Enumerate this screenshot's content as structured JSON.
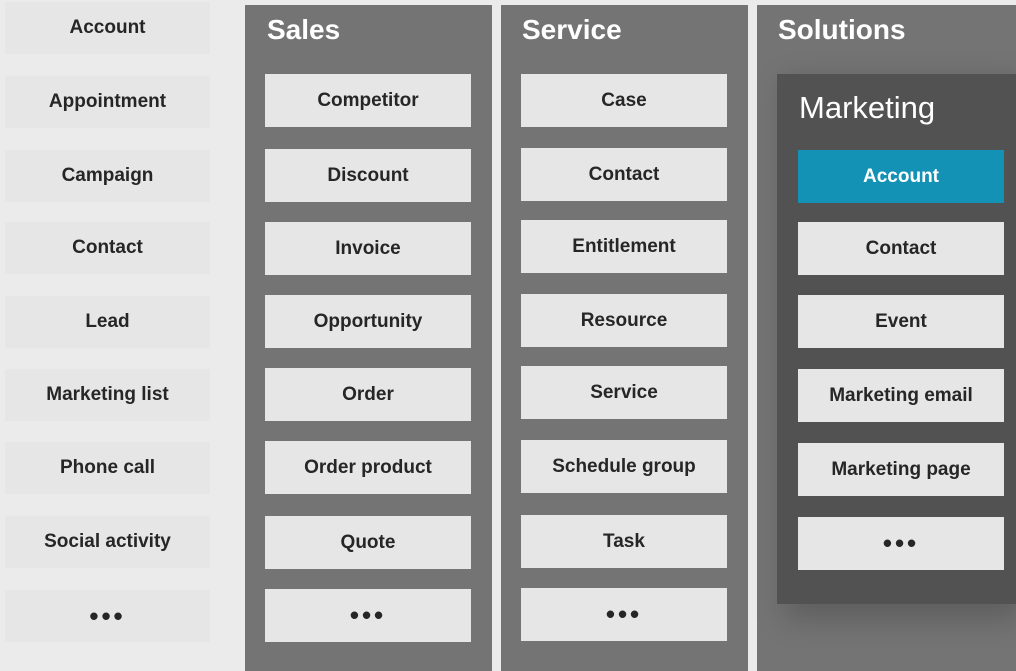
{
  "standalone": {
    "items": [
      "Account",
      "Appointment",
      "Campaign",
      "Contact",
      "Lead",
      "Marketing list",
      "Phone call",
      "Social activity",
      "•••"
    ]
  },
  "sales": {
    "title": "Sales",
    "items": [
      "Competitor",
      "Discount",
      "Invoice",
      "Opportunity",
      "Order",
      "Order product",
      "Quote",
      "•••"
    ]
  },
  "service": {
    "title": "Service",
    "items": [
      "Case",
      "Contact",
      "Entitlement",
      "Resource",
      "Service",
      "Schedule group",
      "Task",
      "•••"
    ]
  },
  "solutions": {
    "title": "Solutions",
    "marketing": {
      "title": "Marketing",
      "items": [
        "Account",
        "Contact",
        "Event",
        "Marketing email",
        "Marketing page",
        "•••"
      ],
      "active_item": "Account",
      "accent_color": "#1492b6"
    }
  },
  "colors": {
    "background": "#ebebeb",
    "panel": "#747474",
    "marketing_panel": "#525252",
    "item": "#e6e6e6"
  }
}
